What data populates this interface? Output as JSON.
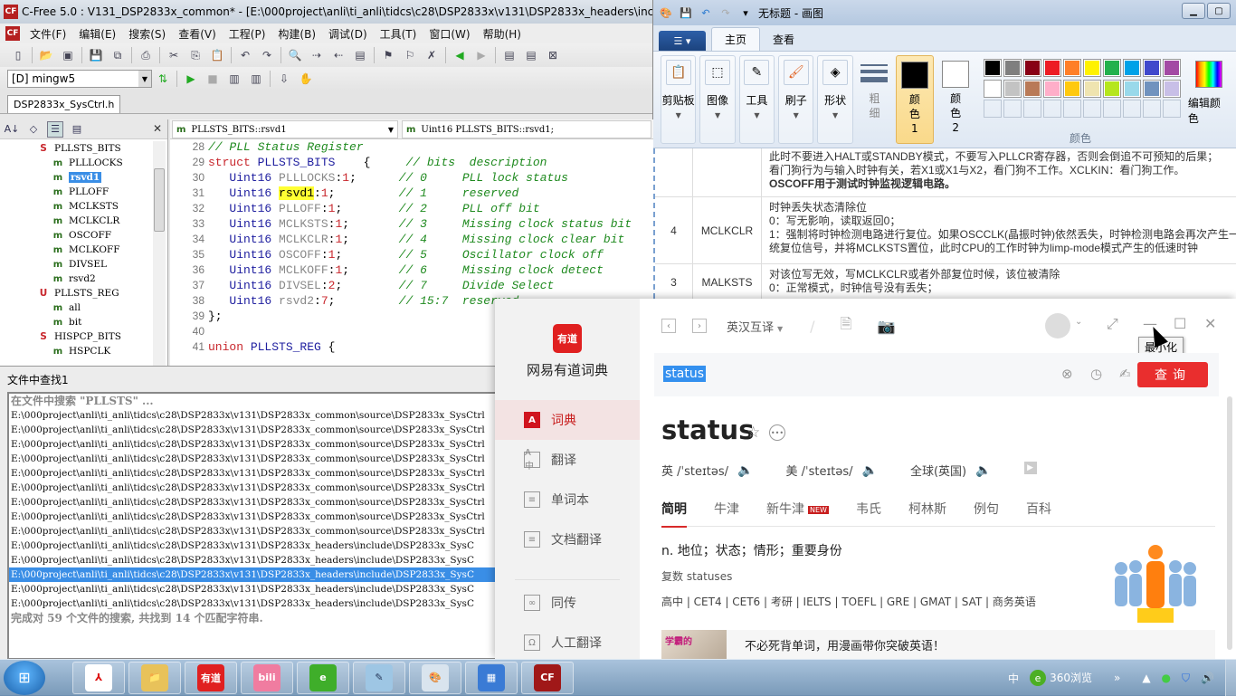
{
  "cfree": {
    "title": "C-Free 5.0 : V131_DSP2833x_common* - [E:\\000project\\anli\\ti_anli\\tidcs\\c28\\DSP2833x\\v131\\DSP2833x_headers\\include\\",
    "menu": [
      "文件(F)",
      "编辑(E)",
      "搜索(S)",
      "查看(V)",
      "工程(P)",
      "构建(B)",
      "调试(D)",
      "工具(T)",
      "窗口(W)",
      "帮助(H)"
    ],
    "compiler": "[D] mingw5",
    "file_tab": "DSP2833x_SysCtrl.h",
    "tree": [
      {
        "kind": "S",
        "label": "PLLSTS_BITS",
        "level": 0
      },
      {
        "kind": "m",
        "label": "PLLLOCKS",
        "level": 1
      },
      {
        "kind": "m",
        "label": "rsvd1",
        "level": 1,
        "selected": true
      },
      {
        "kind": "m",
        "label": "PLLOFF",
        "level": 1
      },
      {
        "kind": "m",
        "label": "MCLKSTS",
        "level": 1
      },
      {
        "kind": "m",
        "label": "MCLKCLR",
        "level": 1
      },
      {
        "kind": "m",
        "label": "OSCOFF",
        "level": 1
      },
      {
        "kind": "m",
        "label": "MCLKOFF",
        "level": 1
      },
      {
        "kind": "m",
        "label": "DIVSEL",
        "level": 1
      },
      {
        "kind": "m",
        "label": "rsvd2",
        "level": 1
      },
      {
        "kind": "U",
        "label": "PLLSTS_REG",
        "level": 0
      },
      {
        "kind": "m",
        "label": "all",
        "level": 1
      },
      {
        "kind": "m",
        "label": "bit",
        "level": 1
      },
      {
        "kind": "S",
        "label": "HISPCP_BITS",
        "level": 0
      },
      {
        "kind": "m",
        "label": "HSPCLK",
        "level": 1
      }
    ],
    "scope_combo": "PLLSTS_BITS::rsvd1",
    "symbol_combo": "Uint16 PLLSTS_BITS::rsvd1;",
    "code": [
      {
        "n": "28",
        "parts": [
          [
            "cm",
            "// PLL Status Register"
          ]
        ]
      },
      {
        "n": "29",
        "parts": [
          [
            "kw",
            "struct "
          ],
          [
            "tn",
            "PLLSTS_BITS"
          ],
          [
            "",
            "    {     "
          ],
          [
            "cm",
            "// bits  description"
          ]
        ]
      },
      {
        "n": "30",
        "parts": [
          [
            "",
            "   "
          ],
          [
            "ty",
            "Uint16 "
          ],
          [
            "id",
            "PLLLOCKS"
          ],
          [
            "",
            ":"
          ],
          [
            "num",
            "1"
          ],
          [
            "",
            ";      "
          ],
          [
            "cm",
            "// 0     PLL lock status"
          ]
        ]
      },
      {
        "n": "31",
        "parts": [
          [
            "",
            "   "
          ],
          [
            "ty",
            "Uint16 "
          ],
          [
            "hl",
            "rsvd1"
          ],
          [
            "",
            ":"
          ],
          [
            "num",
            "1"
          ],
          [
            "",
            ";         "
          ],
          [
            "cm",
            "// 1     reserved"
          ]
        ]
      },
      {
        "n": "32",
        "parts": [
          [
            "",
            "   "
          ],
          [
            "ty",
            "Uint16 "
          ],
          [
            "id",
            "PLLOFF"
          ],
          [
            "",
            ":"
          ],
          [
            "num",
            "1"
          ],
          [
            "",
            ";        "
          ],
          [
            "cm",
            "// 2     PLL off bit"
          ]
        ]
      },
      {
        "n": "33",
        "parts": [
          [
            "",
            "   "
          ],
          [
            "ty",
            "Uint16 "
          ],
          [
            "id",
            "MCLKSTS"
          ],
          [
            "",
            ":"
          ],
          [
            "num",
            "1"
          ],
          [
            "",
            ";       "
          ],
          [
            "cm",
            "// 3     Missing clock status bit"
          ]
        ]
      },
      {
        "n": "34",
        "parts": [
          [
            "",
            "   "
          ],
          [
            "ty",
            "Uint16 "
          ],
          [
            "id",
            "MCLKCLR"
          ],
          [
            "",
            ":"
          ],
          [
            "num",
            "1"
          ],
          [
            "",
            ";       "
          ],
          [
            "cm",
            "// 4     Missing clock clear bit"
          ]
        ]
      },
      {
        "n": "35",
        "parts": [
          [
            "",
            "   "
          ],
          [
            "ty",
            "Uint16 "
          ],
          [
            "id",
            "OSCOFF"
          ],
          [
            "",
            ":"
          ],
          [
            "num",
            "1"
          ],
          [
            "",
            ";        "
          ],
          [
            "cm",
            "// 5     Oscillator clock off"
          ]
        ]
      },
      {
        "n": "36",
        "parts": [
          [
            "",
            "   "
          ],
          [
            "ty",
            "Uint16 "
          ],
          [
            "id",
            "MCLKOFF"
          ],
          [
            "",
            ":"
          ],
          [
            "num",
            "1"
          ],
          [
            "",
            ";       "
          ],
          [
            "cm",
            "// 6     Missing clock detect"
          ]
        ]
      },
      {
        "n": "37",
        "parts": [
          [
            "",
            "   "
          ],
          [
            "ty",
            "Uint16 "
          ],
          [
            "id",
            "DIVSEL"
          ],
          [
            "",
            ":"
          ],
          [
            "num",
            "2"
          ],
          [
            "",
            ";        "
          ],
          [
            "cm",
            "// 7     Divide Select"
          ]
        ]
      },
      {
        "n": "38",
        "parts": [
          [
            "",
            "   "
          ],
          [
            "ty",
            "Uint16 "
          ],
          [
            "id",
            "rsvd2"
          ],
          [
            "",
            ":"
          ],
          [
            "num",
            "7"
          ],
          [
            "",
            ";         "
          ],
          [
            "cm",
            "// 15:7  reserved"
          ]
        ]
      },
      {
        "n": "39",
        "parts": [
          [
            "",
            "};"
          ]
        ]
      },
      {
        "n": "40",
        "parts": [
          [
            "",
            ""
          ]
        ]
      },
      {
        "n": "41",
        "parts": [
          [
            "kw",
            "union "
          ],
          [
            "tn",
            "PLLSTS_REG"
          ],
          [
            "",
            " {"
          ]
        ]
      }
    ],
    "find_panel": {
      "title": "文件中查找1",
      "header": "在文件中搜索 \"PLLSTS\" ...",
      "results": [
        "E:\\000project\\anli\\ti_anli\\tidcs\\c28\\DSP2833x\\v131\\DSP2833x_common\\source\\DSP2833x_SysCtrl",
        "E:\\000project\\anli\\ti_anli\\tidcs\\c28\\DSP2833x\\v131\\DSP2833x_common\\source\\DSP2833x_SysCtrl",
        "E:\\000project\\anli\\ti_anli\\tidcs\\c28\\DSP2833x\\v131\\DSP2833x_common\\source\\DSP2833x_SysCtrl",
        "E:\\000project\\anli\\ti_anli\\tidcs\\c28\\DSP2833x\\v131\\DSP2833x_common\\source\\DSP2833x_SysCtrl",
        "E:\\000project\\anli\\ti_anli\\tidcs\\c28\\DSP2833x\\v131\\DSP2833x_common\\source\\DSP2833x_SysCtrl",
        "E:\\000project\\anli\\ti_anli\\tidcs\\c28\\DSP2833x\\v131\\DSP2833x_common\\source\\DSP2833x_SysCtrl",
        "E:\\000project\\anli\\ti_anli\\tidcs\\c28\\DSP2833x\\v131\\DSP2833x_common\\source\\DSP2833x_SysCtrl",
        "E:\\000project\\anli\\ti_anli\\tidcs\\c28\\DSP2833x\\v131\\DSP2833x_common\\source\\DSP2833x_SysCtrl",
        "E:\\000project\\anli\\ti_anli\\tidcs\\c28\\DSP2833x\\v131\\DSP2833x_common\\source\\DSP2833x_SysCtrl",
        "E:\\000project\\anli\\ti_anli\\tidcs\\c28\\DSP2833x\\v131\\DSP2833x_headers\\include\\DSP2833x_SysC",
        "E:\\000project\\anli\\ti_anli\\tidcs\\c28\\DSP2833x\\v131\\DSP2833x_headers\\include\\DSP2833x_SysC",
        "E:\\000project\\anli\\ti_anli\\tidcs\\c28\\DSP2833x\\v131\\DSP2833x_headers\\include\\DSP2833x_SysC",
        "E:\\000project\\anli\\ti_anli\\tidcs\\c28\\DSP2833x\\v131\\DSP2833x_headers\\include\\DSP2833x_SysC",
        "E:\\000project\\anli\\ti_anli\\tidcs\\c28\\DSP2833x\\v131\\DSP2833x_headers\\include\\DSP2833x_SysC"
      ],
      "selected_index": 11,
      "footer": "完成对 59 个文件的搜索, 共找到 14 个匹配字符串."
    }
  },
  "paint": {
    "title": "无标题 - 画图",
    "tabs": [
      "主页",
      "查看"
    ],
    "groups": [
      "剪贴板",
      "图像",
      "工具",
      "刷子",
      "形状"
    ],
    "thickness": "粗细",
    "color1": "颜色 1",
    "color2": "颜色 2",
    "color1_value": "#000000",
    "color2_value": "#ffffff",
    "palette_row1": [
      "#000000",
      "#7f7f7f",
      "#880015",
      "#ed1c24",
      "#ff7f27",
      "#fff200",
      "#22b14c",
      "#00a2e8",
      "#3f48cc",
      "#a349a4"
    ],
    "palette_row2": [
      "#ffffff",
      "#c3c3c3",
      "#b97a57",
      "#ffaec9",
      "#ffc90e",
      "#efe4b0",
      "#b5e61d",
      "#99d9ea",
      "#7092be",
      "#c8bfe7"
    ],
    "palette_label": "颜色",
    "edit_colors": "编辑颜色",
    "canvas_rows": [
      {
        "bit": "",
        "name": "",
        "lines": [
          "此时不要进入HALT或STANDBY模式，不要写入PLLCR寄存器，否则会倒追不可预知的后果；",
          "看门狗行为与输入时钟有关，若X1或X1与X2，看门狗不工作。XCLKIN：看门狗工作。",
          "OSCOFF用于测试时钟监视逻辑电路。"
        ]
      },
      {
        "bit": "4",
        "name": "MCLKCLR",
        "lines": [
          "时钟丢失状态清除位",
          "0：写无影响，读取返回0；",
          "1：强制将时钟检测电路进行复位。如果OSCCLK(晶振时钟)依然丢失，时钟检测电路会再次产生一",
          "统复位信号，并将MCLKSTS置位，此时CPU的工作时钟为limp-mode模式产生的低速时钟"
        ]
      },
      {
        "bit": "3",
        "name": "MALKSTS",
        "lines": [
          "对该位写无效，写MCLKCLR或者外部复位时候，该位被清除",
          "0：正常模式，时钟信号没有丢失；"
        ]
      }
    ]
  },
  "youdao": {
    "app_name": "网易有道词典",
    "logo_text": "有道",
    "nav": [
      {
        "label": "词典",
        "icon": "A",
        "active": true
      },
      {
        "label": "翻译",
        "icon": "A中"
      },
      {
        "label": "单词本",
        "icon": "≡"
      },
      {
        "label": "文档翻译",
        "icon": "≡"
      },
      {
        "label": "同传",
        "icon": "∞"
      },
      {
        "label": "人工翻译",
        "icon": "Ω"
      }
    ],
    "mode": "英汉互译",
    "tooltip": "最小化",
    "search_value": "status",
    "query_button": "查询",
    "word": "status",
    "phonetics": [
      {
        "label": "英 /ˈsteɪtəs/"
      },
      {
        "label": "美 /ˈsteɪtəs/"
      },
      {
        "label": "全球(英国)"
      }
    ],
    "dict_tabs": [
      "简明",
      "牛津",
      "新牛津",
      "韦氏",
      "柯林斯",
      "例句",
      "百科"
    ],
    "new_badge": "NEW",
    "definition": "n. 地位；状态；情形；重要身份",
    "plural": "复数 statuses",
    "levels": "高中 | CET4 | CET6 | 考研 | IELTS | TOEFL | GRE | GMAT | SAT | 商务英语",
    "ad_thumb": "学霸的",
    "ad_text": "不必死背单词，用漫画带你突破英语！"
  },
  "taskbar": {
    "apps": [
      {
        "name": "acrobat",
        "glyph": "⅄",
        "bg": "#ffffff",
        "fg": "#d11"
      },
      {
        "name": "file-explorer",
        "glyph": "📁",
        "bg": "#e8c25a",
        "fg": "#fff"
      },
      {
        "name": "youdao",
        "glyph": "有道",
        "bg": "#e02020",
        "fg": "#fff"
      },
      {
        "name": "bilibili",
        "glyph": "bili",
        "bg": "#f07ca0",
        "fg": "#fff"
      },
      {
        "name": "360-browser",
        "glyph": "e",
        "bg": "#3fae2a",
        "fg": "#fff"
      },
      {
        "name": "notepad",
        "glyph": "✎",
        "bg": "#9ec6e4",
        "fg": "#235"
      },
      {
        "name": "paint",
        "glyph": "🎨",
        "bg": "#d9e4ee",
        "fg": "#333"
      },
      {
        "name": "control-panel",
        "glyph": "▦",
        "bg": "#3a7bd5",
        "fg": "#fff"
      },
      {
        "name": "c-free",
        "glyph": "CF",
        "bg": "#a01818",
        "fg": "#fff"
      }
    ],
    "ime": "中",
    "browser_label": "360浏览",
    "expand": "»"
  }
}
